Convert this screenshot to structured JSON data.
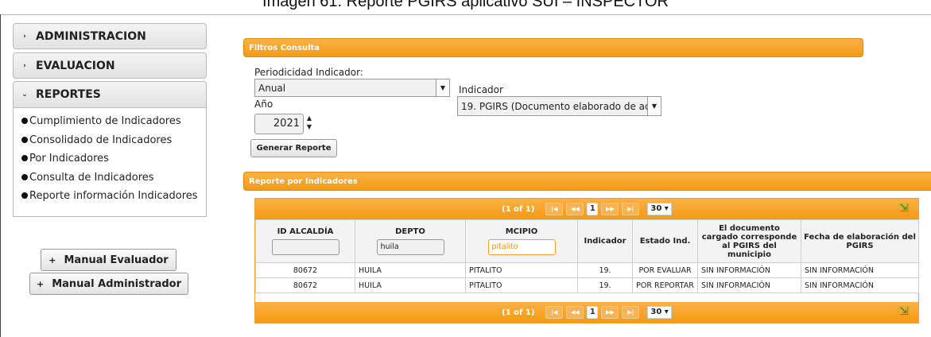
{
  "caption": "Imagen 61.  Reporte PGIRS aplicativo SUI – INSPECTOR",
  "menu": {
    "sections": [
      {
        "label": "ADMINISTRACION",
        "arrow": "›"
      },
      {
        "label": "EVALUACION",
        "arrow": "›"
      },
      {
        "label": "REPORTES",
        "arrow": "⌄"
      }
    ],
    "items": [
      "Cumplimiento de Indicadores",
      "Consolidado de Indicadores",
      "Por Indicadores",
      "Consulta de Indicadores",
      "Reporte información Indicadores"
    ]
  },
  "manuals": {
    "evaluador": "Manual Evaluador",
    "administrador": "Manual Administrador",
    "plus": "+"
  },
  "filtros": {
    "header": "Filtros Consulta",
    "periodicidad_label": "Periodicidad Indicador:",
    "periodicidad_value": "Anual",
    "anio_label": "Año",
    "anio_value": "2021",
    "indicador_label": "Indicador",
    "indicador_value": "19. PGIRS (Documento elaborado de ac",
    "button": "Generar Reporte"
  },
  "reporte": {
    "header": "Reporte por Indicadores",
    "pager": {
      "count": "(1 of 1)",
      "first": "|◀",
      "prev": "◀◀",
      "page": "1",
      "next": "▶▶",
      "last": "▶|",
      "rows_per_page": "30"
    },
    "columns": [
      "ID ALCALDÍA",
      "DEPTO",
      "MCIPIO",
      "Indicador",
      "Estado Ind.",
      "El documento cargado corresponde al PGIRS del municipio",
      "Fecha de elaboración del PGIRS"
    ],
    "filters": {
      "id": "",
      "depto": "huila",
      "mcipio": "pitalito"
    },
    "rows": [
      [
        "80672",
        "HUILA",
        "PITALITO",
        "19.",
        "POR EVALUAR",
        "SIN INFORMACIÓN",
        "SIN INFORMACIÓN"
      ],
      [
        "80672",
        "HUILA",
        "PITALITO",
        "19.",
        "POR REPORTAR",
        "SIN INFORMACIÓN",
        "SIN INFORMACIÓN"
      ]
    ]
  },
  "colors": {
    "accent": "#f59a13"
  }
}
